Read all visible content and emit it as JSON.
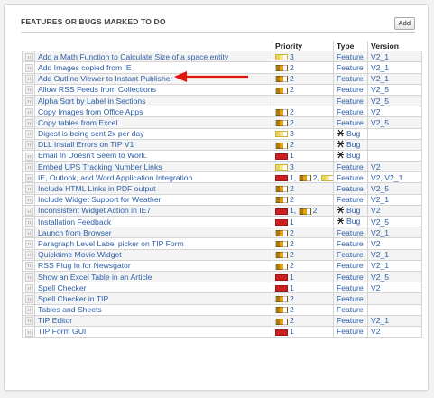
{
  "panel": {
    "title": "FEATURES OR BUGS MARKED TO DO",
    "add_label": "Add"
  },
  "columns": {
    "priority": "Priority",
    "type": "Type",
    "version": "Version"
  },
  "colors": {
    "link": "#2a5da8",
    "p1": "#cc1f1f",
    "p2": "#e0a416",
    "p3": "#e8d55a",
    "arrow": "#e0140c"
  },
  "rows": [
    {
      "title": "Add a Math Function to Calculate Size of a space entity",
      "prio": [
        {
          "level": 3,
          "label": "3"
        }
      ],
      "type": "Feature",
      "bug": false,
      "version": "V2_1"
    },
    {
      "title": "Add Images copied from IE",
      "prio": [
        {
          "level": 2,
          "label": "2"
        }
      ],
      "type": "Feature",
      "bug": false,
      "version": "V2_1"
    },
    {
      "title": "Add Outline Viewer to Instant Publisher",
      "prio": [
        {
          "level": 2,
          "label": "2"
        }
      ],
      "type": "Feature",
      "bug": false,
      "version": "V2_1"
    },
    {
      "title": "Allow RSS Feeds from Collections",
      "prio": [
        {
          "level": 2,
          "label": "2"
        }
      ],
      "type": "Feature",
      "bug": false,
      "version": "V2_5"
    },
    {
      "title": "Alpha Sort by Label in Sections",
      "prio": [],
      "type": "Feature",
      "bug": false,
      "version": "V2_5"
    },
    {
      "title": "Copy Images from Office Apps",
      "prio": [
        {
          "level": 2,
          "label": "2"
        }
      ],
      "type": "Feature",
      "bug": false,
      "version": "V2"
    },
    {
      "title": "Copy tables from Excel",
      "prio": [
        {
          "level": 2,
          "label": "2"
        }
      ],
      "type": "Feature",
      "bug": false,
      "version": "V2_5"
    },
    {
      "title": "Digest is being sent 2x per day",
      "prio": [
        {
          "level": 3,
          "label": "3"
        }
      ],
      "type": "Bug",
      "bug": true,
      "version": ""
    },
    {
      "title": "DLL Install Errors on TIP V1",
      "prio": [
        {
          "level": 2,
          "label": "2"
        }
      ],
      "type": "Bug",
      "bug": true,
      "version": ""
    },
    {
      "title": "Email In Doesn't Seem to Work.",
      "prio": [
        {
          "level": 1,
          "label": "1"
        }
      ],
      "type": "Bug",
      "bug": true,
      "version": ""
    },
    {
      "title": "Embed UPS Tracking Number Links",
      "prio": [
        {
          "level": 3,
          "label": "3"
        }
      ],
      "type": "Feature",
      "bug": false,
      "version": "V2"
    },
    {
      "title": "IE, Outlook, and Word Application Integration",
      "prio": [
        {
          "level": 1,
          "label": "1,"
        },
        {
          "level": 2,
          "label": "2,"
        },
        {
          "level": 3,
          "label": "3"
        }
      ],
      "type": "Feature",
      "bug": false,
      "version": "V2, V2_1"
    },
    {
      "title": "Include HTML Links in PDF output",
      "prio": [
        {
          "level": 2,
          "label": "2"
        }
      ],
      "type": "Feature",
      "bug": false,
      "version": "V2_5"
    },
    {
      "title": "Include Widget Support for Weather",
      "prio": [
        {
          "level": 2,
          "label": "2"
        }
      ],
      "type": "Feature",
      "bug": false,
      "version": "V2_1"
    },
    {
      "title": "Inconsistent Widget Action in IE7",
      "prio": [
        {
          "level": 1,
          "label": "1,"
        },
        {
          "level": 2,
          "label": "2"
        }
      ],
      "type": "Bug",
      "bug": true,
      "version": "V2"
    },
    {
      "title": "Installation Feedback",
      "prio": [
        {
          "level": 1,
          "label": "1"
        }
      ],
      "type": "Bug",
      "bug": true,
      "version": "V2_5"
    },
    {
      "title": "Launch from Browser",
      "prio": [
        {
          "level": 2,
          "label": "2"
        }
      ],
      "type": "Feature",
      "bug": false,
      "version": "V2_1"
    },
    {
      "title": "Paragraph Level Label picker on TIP Form",
      "prio": [
        {
          "level": 2,
          "label": "2"
        }
      ],
      "type": "Feature",
      "bug": false,
      "version": "V2"
    },
    {
      "title": "Quicktime Movie Widget",
      "prio": [
        {
          "level": 2,
          "label": "2"
        }
      ],
      "type": "Feature",
      "bug": false,
      "version": "V2_1"
    },
    {
      "title": "RSS Plug In for Newsgator",
      "prio": [
        {
          "level": 2,
          "label": "2"
        }
      ],
      "type": "Feature",
      "bug": false,
      "version": "V2_1"
    },
    {
      "title": "Show an Excel Table in an Article",
      "prio": [
        {
          "level": 1,
          "label": "1"
        }
      ],
      "type": "Feature",
      "bug": false,
      "version": "V2_5"
    },
    {
      "title": "Spell Checker",
      "prio": [
        {
          "level": 1,
          "label": "1"
        }
      ],
      "type": "Feature",
      "bug": false,
      "version": "V2"
    },
    {
      "title": "Spell Checker in TIP",
      "prio": [
        {
          "level": 2,
          "label": "2"
        }
      ],
      "type": "Feature",
      "bug": false,
      "version": ""
    },
    {
      "title": "Tables and Sheets",
      "prio": [
        {
          "level": 2,
          "label": "2"
        }
      ],
      "type": "Feature",
      "bug": false,
      "version": ""
    },
    {
      "title": "TIP Editor",
      "prio": [
        {
          "level": 2,
          "label": "2"
        }
      ],
      "type": "Feature",
      "bug": false,
      "version": "V2_1"
    },
    {
      "title": "TIP Form GUI",
      "prio": [
        {
          "level": 1,
          "label": "1"
        }
      ],
      "type": "Feature",
      "bug": false,
      "version": "V2"
    }
  ]
}
